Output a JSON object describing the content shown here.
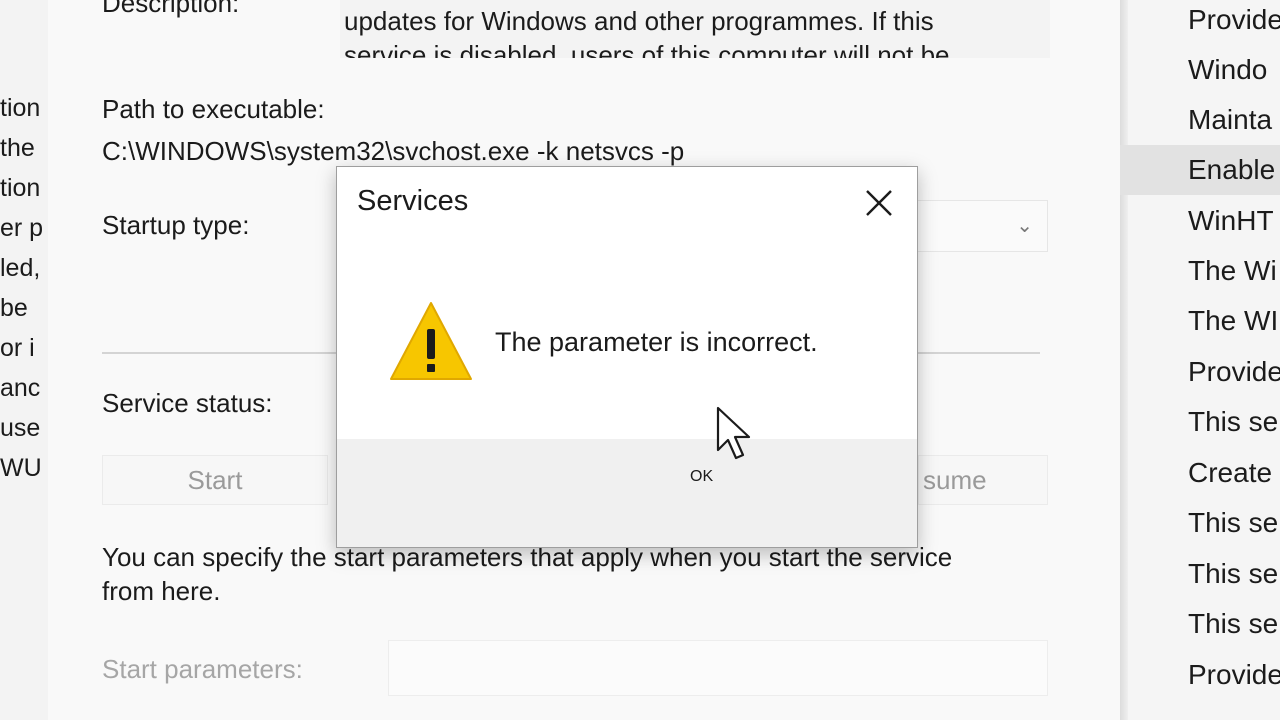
{
  "background_left": {
    "fragments": [
      "tion",
      " the",
      "tion",
      "er p",
      "led,",
      " be",
      "or i",
      " anc",
      "use",
      "WU"
    ]
  },
  "properties": {
    "description_label": "Description:",
    "description_lines": [
      "updates for Windows and other programmes. If this",
      "service is disabled, users of this computer will not be"
    ],
    "path_label": "Path to executable:",
    "path_value": "C:\\WINDOWS\\system32\\svchost.exe -k netsvcs -p",
    "startup_type_label": "Startup type:",
    "service_status_label": "Service status:",
    "start_button": "Start",
    "resume_button": "sume",
    "start_params_help": [
      "You can specify the start parameters that apply when you start the service",
      "from here."
    ],
    "start_params_label": "Start parameters:"
  },
  "dialog": {
    "title": "Services",
    "message": "The parameter is incorrect.",
    "ok_label": "OK",
    "icon": "warning-icon",
    "accent_color": "#0a64c8",
    "warning_color": "#f7c600"
  },
  "background_right": {
    "items": [
      {
        "text": "Provide",
        "selected": false
      },
      {
        "text": "Windo",
        "selected": false
      },
      {
        "text": "Mainta",
        "selected": false
      },
      {
        "text": "Enable",
        "selected": true
      },
      {
        "text": "WinHT",
        "selected": false
      },
      {
        "text": "The Wi",
        "selected": false
      },
      {
        "text": "The WI",
        "selected": false
      },
      {
        "text": "Provide",
        "selected": false
      },
      {
        "text": "This se",
        "selected": false
      },
      {
        "text": "Create",
        "selected": false
      },
      {
        "text": "This se",
        "selected": false
      },
      {
        "text": "This se",
        "selected": false
      },
      {
        "text": "This se",
        "selected": false
      },
      {
        "text": "Provide",
        "selected": false
      }
    ]
  }
}
